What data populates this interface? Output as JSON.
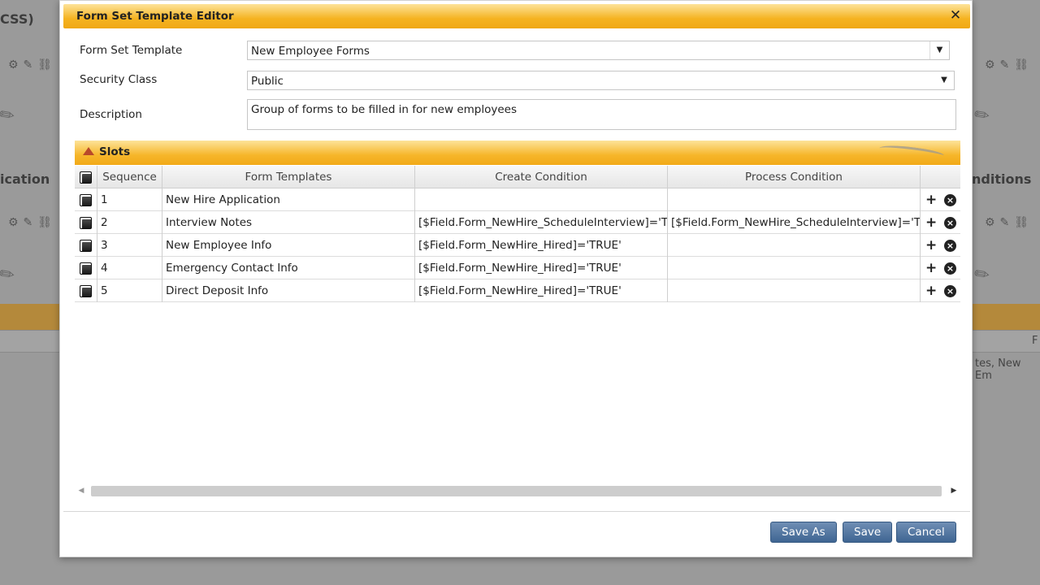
{
  "background": {
    "css_label": "CSS)",
    "ication_label": "ication",
    "nditions_label": "nditions",
    "fragment_text": "tes, New Em",
    "f_label": "F"
  },
  "dialog": {
    "title": "Form Set Template Editor",
    "close_icon": "close-icon",
    "fields": {
      "form_set_template_label": "Form Set Template",
      "form_set_template_value": "New Employee Forms",
      "security_class_label": "Security Class",
      "security_class_value": "Public",
      "description_label": "Description",
      "description_value": "Group of forms to be filled in for new employees"
    },
    "slots": {
      "title": "Slots",
      "columns": [
        "Sequence",
        "Form Templates",
        "Create Condition",
        "Process Condition"
      ],
      "rows": [
        {
          "sequence": "1",
          "form_template": "New Hire Application",
          "create_condition": "",
          "process_condition": ""
        },
        {
          "sequence": "2",
          "form_template": "Interview Notes",
          "create_condition": "[$Field.Form_NewHire_ScheduleInterview]='T",
          "process_condition": "[$Field.Form_NewHire_ScheduleInterview]='T"
        },
        {
          "sequence": "3",
          "form_template": "New Employee Info",
          "create_condition": "[$Field.Form_NewHire_Hired]='TRUE'",
          "process_condition": ""
        },
        {
          "sequence": "4",
          "form_template": "Emergency Contact Info",
          "create_condition": "[$Field.Form_NewHire_Hired]='TRUE'",
          "process_condition": ""
        },
        {
          "sequence": "5",
          "form_template": "Direct Deposit Info",
          "create_condition": "[$Field.Form_NewHire_Hired]='TRUE'",
          "process_condition": ""
        }
      ],
      "add_icon": "+",
      "remove_icon": "×"
    },
    "buttons": {
      "save_as": "Save As",
      "save": "Save",
      "cancel": "Cancel"
    },
    "colors": {
      "title_bar": "#f5b320",
      "button": "#4f74a0"
    }
  }
}
